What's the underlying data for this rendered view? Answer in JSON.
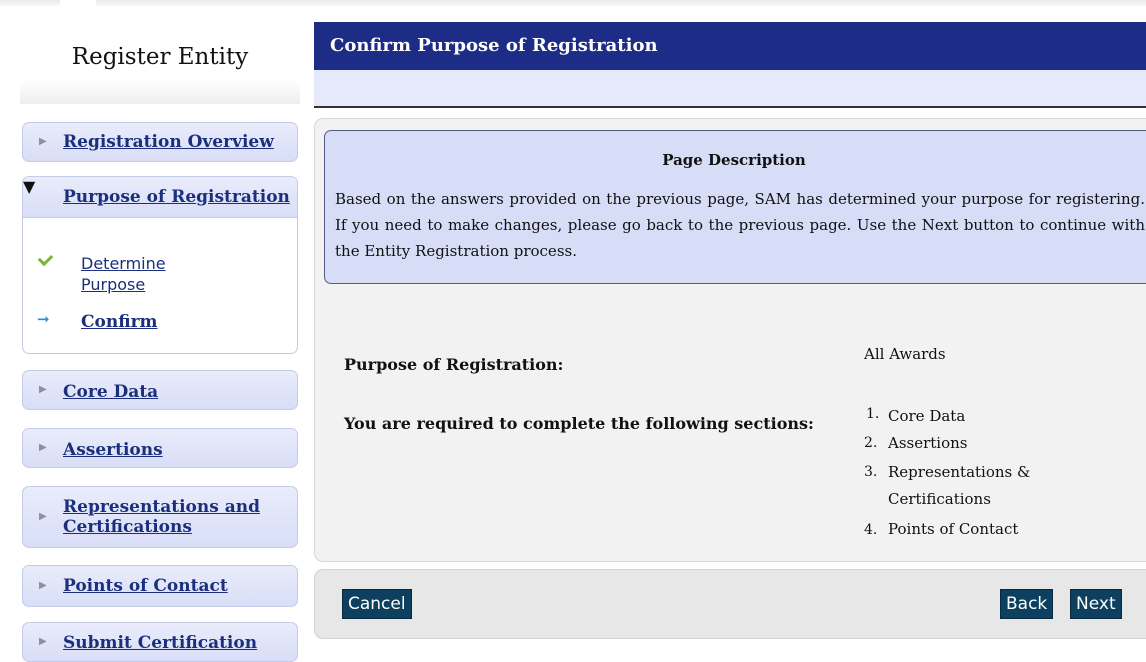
{
  "sidebar": {
    "title": "Register Entity",
    "items": [
      {
        "label": "Registration Overview"
      },
      {
        "label": "Purpose of Registration",
        "expanded": true,
        "subitems": [
          {
            "label": "Determine Purpose",
            "status": "complete"
          },
          {
            "label": "Confirm",
            "status": "current"
          }
        ]
      },
      {
        "label": "Core Data"
      },
      {
        "label": "Assertions"
      },
      {
        "label": "Representations and Certifications"
      },
      {
        "label": "Points of Contact"
      },
      {
        "label": "Submit Certification"
      }
    ]
  },
  "main": {
    "header_title": "Confirm Purpose of Registration",
    "description": {
      "title": "Page Description",
      "text": "Based on the answers provided on the previous page, SAM has determined your purpose for registering. If you need to make changes, please go back to the previous page. Use the Next button to continue with the Entity Registration process."
    },
    "purpose_label": "Purpose of Registration:",
    "purpose_value": "All Awards",
    "sections_label": "You are required to complete the following sections:",
    "sections": [
      {
        "num": "1.",
        "lines": [
          "Core Data"
        ]
      },
      {
        "num": "2.",
        "lines": [
          "Assertions"
        ]
      },
      {
        "num": "3.",
        "lines": [
          "Representations &",
          "Certifications"
        ]
      },
      {
        "num": "4.",
        "lines": [
          "Points of Contact"
        ]
      }
    ]
  },
  "actions": {
    "cancel": "Cancel",
    "back": "Back",
    "next": "Next"
  },
  "colors": {
    "header": "#1d2c86",
    "nav_link": "#1b2f7d",
    "button": "#0d3f5f",
    "desc_box": "#d7dcf7"
  },
  "icons": {
    "collapsed": "triangle-right-icon",
    "expanded": "triangle-down-icon",
    "done": "check-icon",
    "current": "arrow-right-icon"
  }
}
